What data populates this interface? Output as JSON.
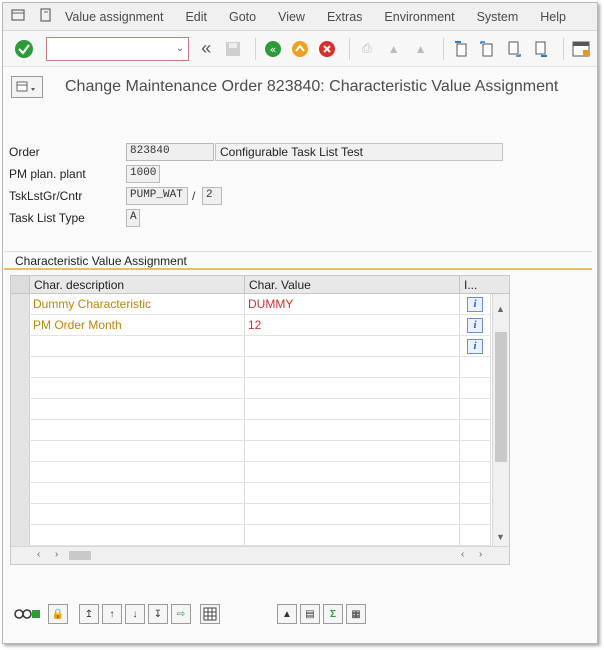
{
  "menu": {
    "items": [
      "Value assignment",
      "Edit",
      "Goto",
      "View",
      "Extras",
      "Environment",
      "System",
      "Help"
    ]
  },
  "toolbar": {
    "okcode_value": ""
  },
  "title": "Change Maintenance Order 823840: Characteristic Value Assignment",
  "header": {
    "order_label": "Order",
    "order_value": "823840",
    "order_desc": "Configurable Task List Test",
    "plant_label": "PM plan. plant",
    "plant_value": "1000",
    "tasklist_label": "TskLstGr/Cntr",
    "tasklist_group": "PUMP_WAT",
    "tasklist_counter": "2",
    "tasklist_type_label": "Task List Type",
    "tasklist_type_value": "A"
  },
  "group": {
    "title": "Characteristic Value Assignment"
  },
  "table": {
    "columns": [
      "Char. description",
      "Char. Value",
      "I..."
    ],
    "rows": [
      {
        "description": "Dummy Characteristic",
        "value": "DUMMY"
      },
      {
        "description": "PM  Order Month",
        "value": "12"
      }
    ]
  },
  "colors": {
    "accent_gold": "#e8bf5b",
    "description_text": "#b8860b",
    "value_text": "#d0302c"
  }
}
